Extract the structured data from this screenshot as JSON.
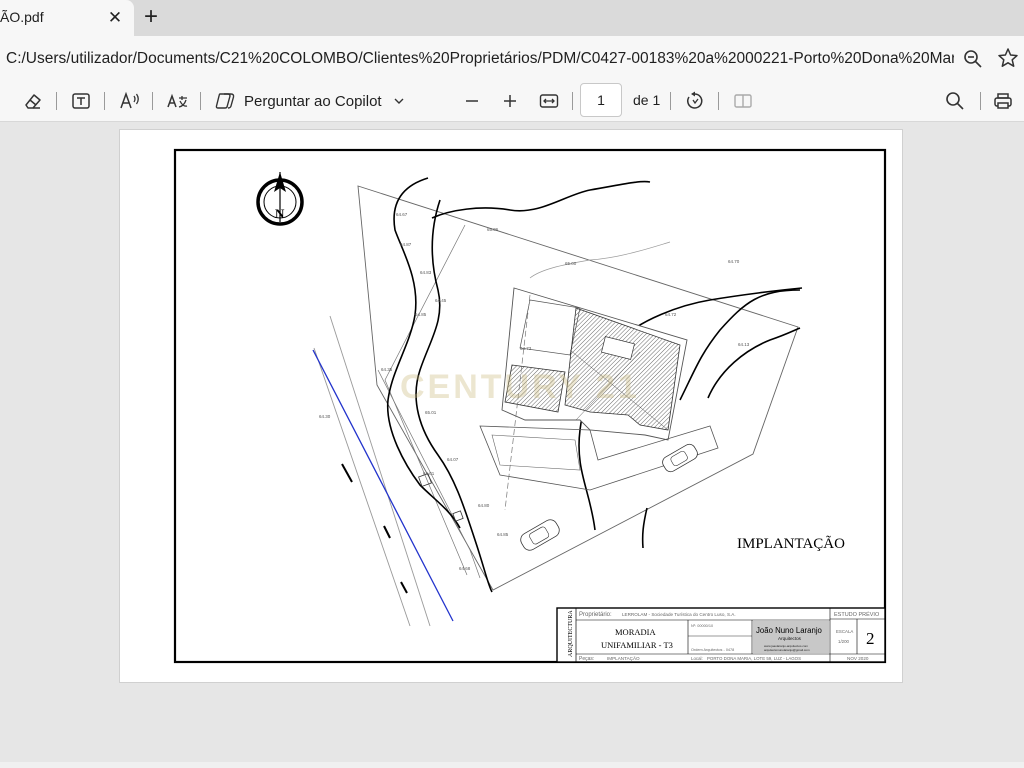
{
  "tab": {
    "title": "ÃO.pdf",
    "close_glyph": "✕",
    "new_tab_glyph": "+"
  },
  "address": {
    "url": "C:/Users/utilizador/Documents/C21%20COLOMBO/Clientes%20Proprietários/PDM/C0427-00183%20a%2000221-Porto%20Dona%20Maria/Ter..."
  },
  "toolbar": {
    "copilot_label": "Perguntar ao Copilot",
    "page_number": "1",
    "page_total": "de 1",
    "icons": [
      "eraser-icon",
      "text-box-icon",
      "read-aloud-icon",
      "translate-icon",
      "copilot-icon",
      "chevron-down-icon",
      "zoom-out-icon",
      "zoom-in-icon",
      "fit-width-icon",
      "rotate-icon",
      "two-page-icon",
      "search-icon",
      "print-icon"
    ]
  },
  "drawing": {
    "north_label": "N",
    "plan_title": "IMPLANTAÇÃO",
    "watermark": "CENTURY 21",
    "cartouche": {
      "discipline": "ARQUITECTURA",
      "proprietario_label": "Proprietário:",
      "proprietario": "LERROLAM - Sociedade Turística do Centro Luso, S.A.",
      "project_line1": "MORADIA",
      "project_line2": "UNIFAMILIAR - T3",
      "pecas_label": "Peças:",
      "pecas": "IMPLANTAÇÃO",
      "ref": "Nº: 00000/10",
      "ordem": "Ordem Arquitectos - 0478",
      "local_label": "Local:",
      "local": "PORTO DONA MARIA, LOTE 59, LUZ - LAGOS",
      "architect": "João Nuno Laranjo",
      "architect_role": "Arquitectos",
      "architect_web": "www.joaolaranjo-arquitectos.com",
      "architect_mail": "arquitectonunolaranjo@gmail.com",
      "fase": "ESTUDO PRÉVIO",
      "escala_label": "ESCALA",
      "escala": "1/200",
      "sheet": "2",
      "date": "NOV 2020"
    },
    "spot_levels": [
      "64.67",
      "65.06",
      "64.87",
      "64.83",
      "64.45",
      "65.00",
      "64.85",
      "64.72",
      "64.13",
      "64.73",
      "64.70",
      "64.30",
      "64.35",
      "65.01",
      "64.07",
      "64.01",
      "64.80",
      "64.85",
      "64.68"
    ]
  }
}
